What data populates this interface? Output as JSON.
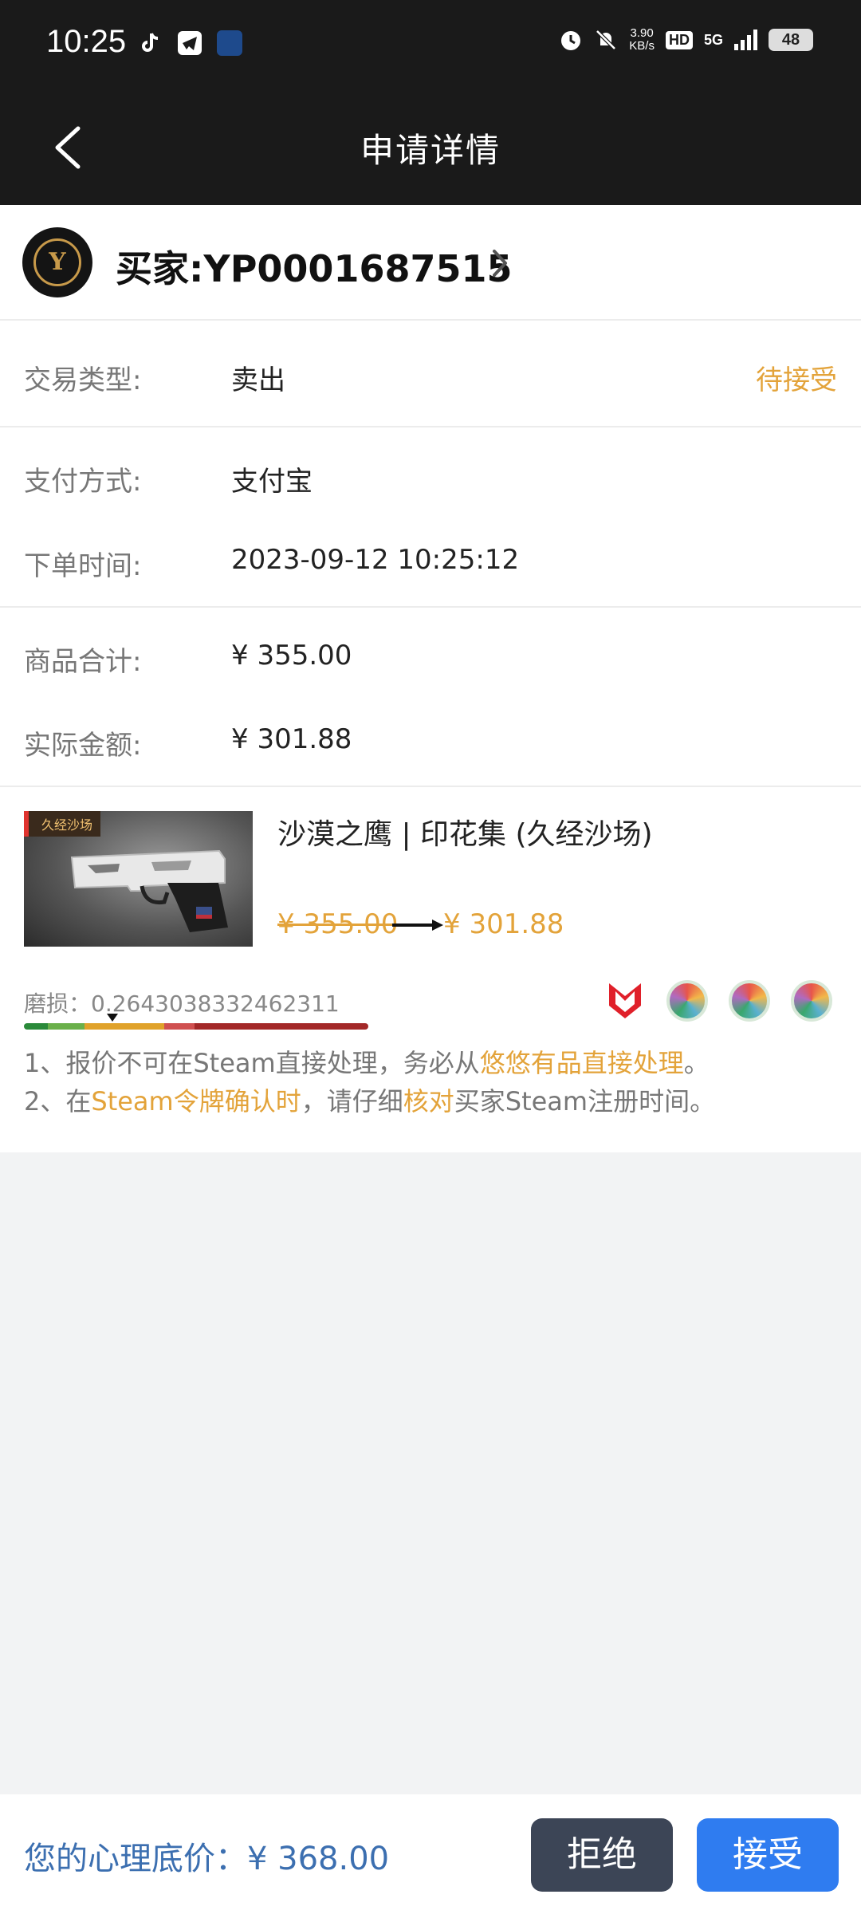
{
  "status_bar": {
    "time": "10:25",
    "net_speed": "3.90\nKB/s",
    "hd": "HD",
    "network": "5G",
    "battery": "48",
    "left_icons": [
      "tiktok-icon",
      "telegram-icon",
      "china-daily-icon"
    ],
    "right_icons": [
      "alarm-icon",
      "mute-icon",
      "signal-icon",
      "battery-icon"
    ]
  },
  "header": {
    "title": "申请详情"
  },
  "buyer": {
    "label": "买家:YP0001687515",
    "avatar_text": "Y"
  },
  "trade": {
    "type_label": "交易类型:",
    "type_value": "卖出",
    "status": "待接受"
  },
  "payment": {
    "method_label": "支付方式:",
    "method_value": "支付宝",
    "time_label": "下单时间:",
    "time_value": "2023-09-12 10:25:12"
  },
  "amounts": {
    "total_label": "商品合计:",
    "total_value": "¥ 355.00",
    "actual_label": "实际金额:",
    "actual_value": "¥ 301.88"
  },
  "product": {
    "tag": "久经沙场",
    "name": "沙漠之鹰 | 印花集 (久经沙场)",
    "price_old": "¥ 355.00",
    "price_new": "¥ 301.88",
    "wear_label": "磨损：0.2643038332462311",
    "wear_value": 0.2643038332462311,
    "stickers": [
      "mousesports-sticker-icon",
      "sticker-capsule-icon",
      "sticker-capsule-icon",
      "sticker-capsule-icon"
    ]
  },
  "notes": {
    "line1_a": "1、报价不可在Steam直接处理，务必从",
    "line1_hl": "悠悠有品直接处理",
    "line1_b": "。",
    "line2_a": "2、在",
    "line2_hl1": "Steam令牌确认时",
    "line2_b": "，请仔细",
    "line2_hl2": "核对",
    "line2_c": "买家Steam注册时间。"
  },
  "bottom": {
    "floor_price": "您的心理底价：¥ 368.00",
    "reject_label": "拒绝",
    "accept_label": "接受"
  },
  "colors": {
    "accent": "#e3a33a",
    "header_bg": "#1a1a1a",
    "reject_bg": "#3c4556",
    "accept_bg": "#2f7cf0",
    "floor_price": "#3c6fb0"
  }
}
